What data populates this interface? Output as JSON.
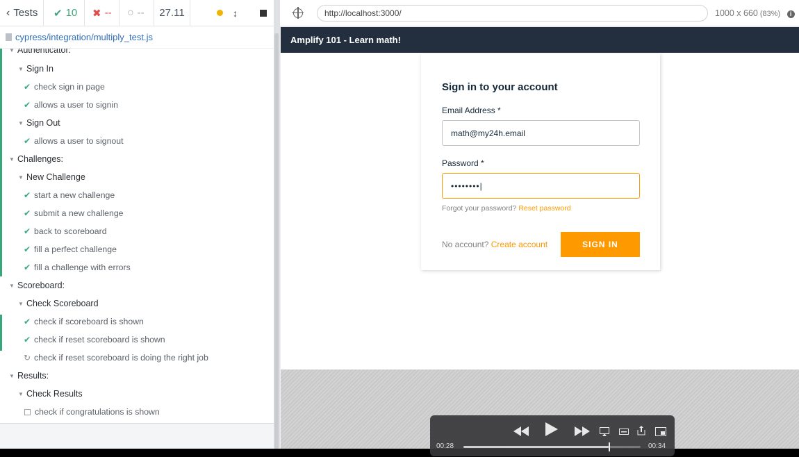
{
  "stats": {
    "tests_label": "Tests",
    "passed": "10",
    "failed": "--",
    "pending": "--",
    "duration": "27.11"
  },
  "spec_file": "cypress/integration/multiply_test.js",
  "tree": {
    "suite_authenticator": "Authenticator:",
    "sub_sign_in": "Sign In",
    "t1": "check sign in page",
    "t2": "allows a user to signin",
    "sub_sign_out": "Sign Out",
    "t3": "allows a user to signout",
    "suite_challenges": "Challenges:",
    "sub_new_challenge": "New Challenge",
    "t4": "start a new challenge",
    "t5": "submit a new challenge",
    "t6": "back to scoreboard",
    "t7": "fill a perfect challenge",
    "t8": "fill a challenge with errors",
    "suite_scoreboard": "Scoreboard:",
    "sub_check_scoreboard": "Check Scoreboard",
    "t9": "check if scoreboard is shown",
    "t10": "check if reset scoreboard is shown",
    "t11": "check if reset scoreboard is doing the right job",
    "suite_results": "Results:",
    "sub_check_results": "Check Results",
    "t12": "check if congratulations is shown"
  },
  "aut": {
    "url": "http://localhost:3000/",
    "viewport": "1000 x 660",
    "scale": "(83%)",
    "info_glyph": "i"
  },
  "app": {
    "nav_title": "Amplify 101 - Learn math!",
    "heading": "Sign in to your account",
    "email_label": "Email Address *",
    "email_value": "math@my24h.email",
    "password_label": "Password *",
    "password_value": "••••••••|",
    "forgot_text": "Forgot your password?",
    "reset_link": "Reset password",
    "no_account_text": "No account?",
    "create_link": "Create account",
    "signin_button": "SIGN IN"
  },
  "video": {
    "current_time": "00:28",
    "total_time": "00:34",
    "progress": 0.82
  },
  "colors": {
    "pass": "#39a77c",
    "fail": "#e04e4e",
    "accent": "#ff9900",
    "nav": "#232f3e"
  }
}
